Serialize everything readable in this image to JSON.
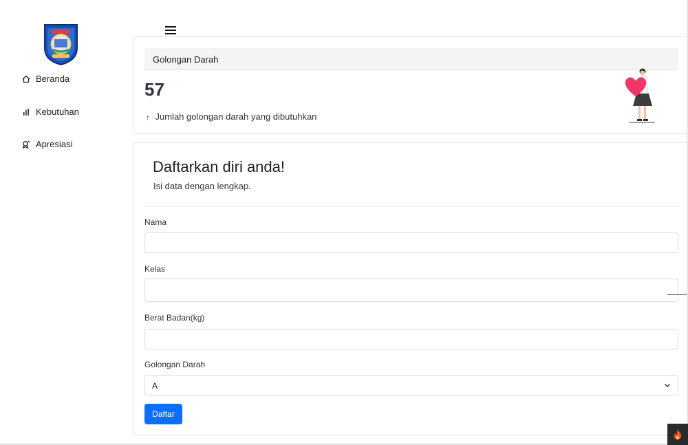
{
  "sidebar": {
    "items": [
      {
        "label": "Beranda",
        "icon": "home-icon"
      },
      {
        "label": "Kebutuhan",
        "icon": "bar-chart-icon"
      },
      {
        "label": "Apresiasi",
        "icon": "award-icon"
      }
    ]
  },
  "stat_card": {
    "header": "Golongan Darah",
    "value": "57",
    "description": "Jumlah golongan darah yang dibutuhkan",
    "trend_icon": "arrow-up-icon"
  },
  "form": {
    "title": "Daftarkan diri anda!",
    "subtitle": "Isi data dengan lengkap.",
    "fields": {
      "nama": {
        "label": "Nama",
        "value": ""
      },
      "kelas": {
        "label": "Kelas",
        "value": ""
      },
      "berat": {
        "label": "Berat Badan(kg)",
        "value": ""
      },
      "golongan": {
        "label": "Golongan Darah",
        "selected": "A"
      }
    },
    "submit_label": "Daftar"
  },
  "colors": {
    "primary": "#0d6efd",
    "heart": "#f0376a",
    "badge_bg": "#2b2b2b",
    "flame": "#ff5a1f"
  }
}
